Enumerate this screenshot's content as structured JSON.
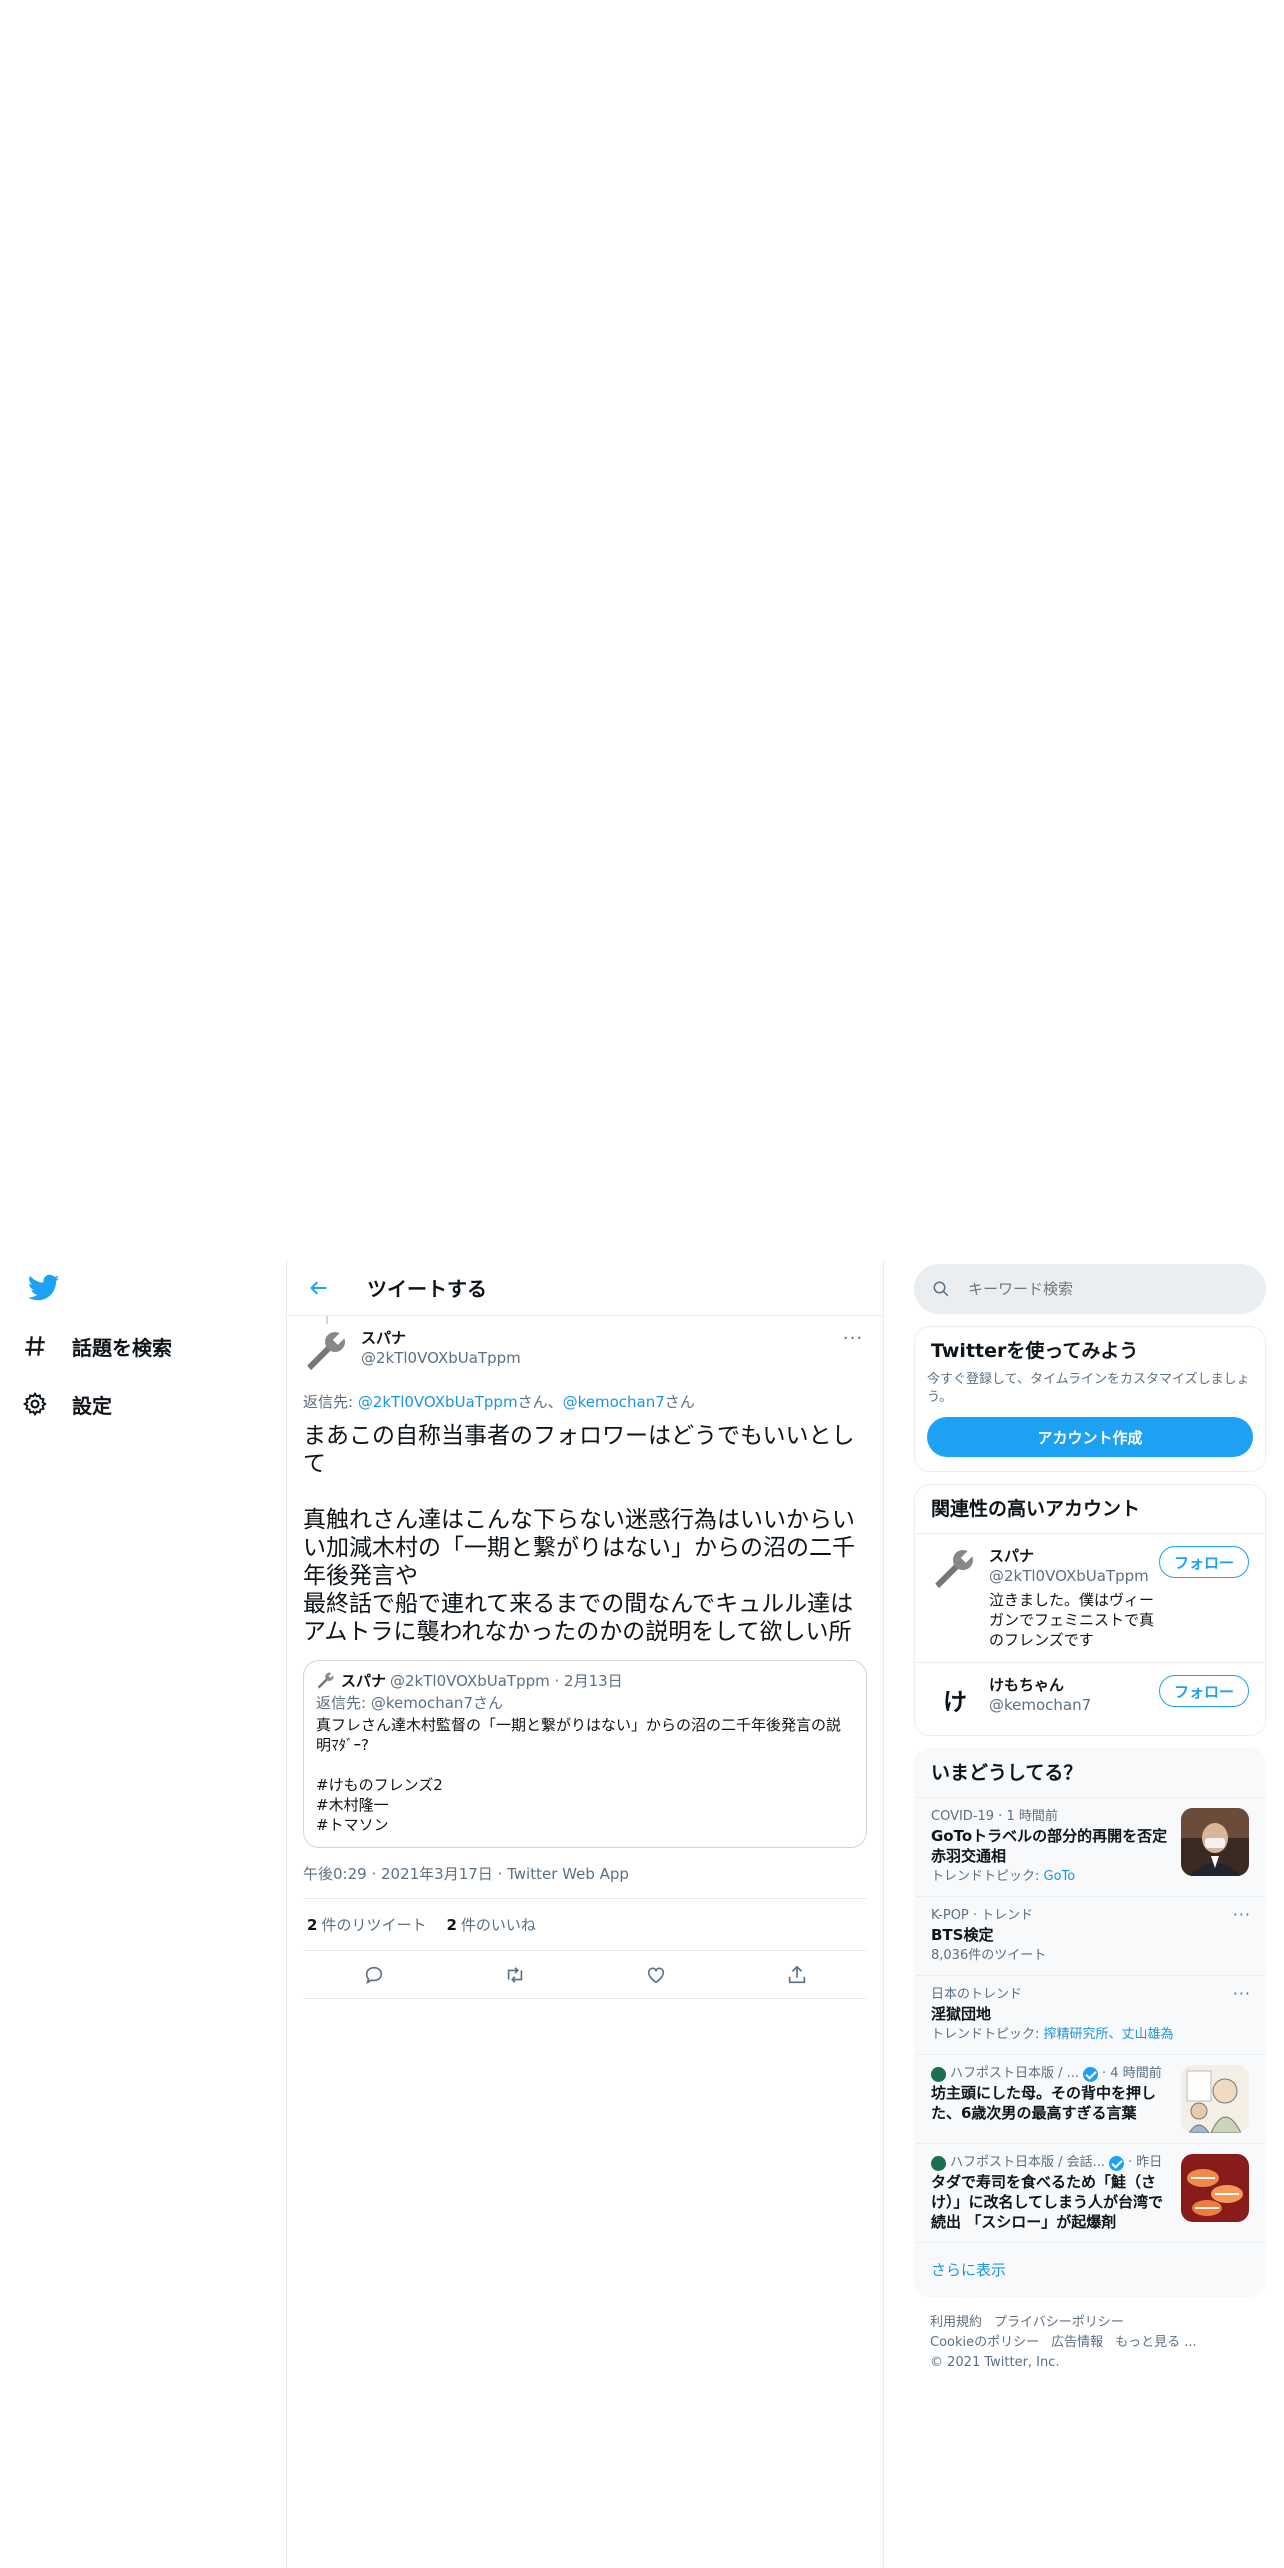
{
  "nav": {
    "logo_icon": "twitter-bird-icon",
    "items": [
      {
        "label": "話題を検索",
        "icon": "hashtag-icon"
      },
      {
        "label": "設定",
        "icon": "gear-icon"
      }
    ]
  },
  "main": {
    "title": "ツイートする",
    "tweet": {
      "name": "スパナ",
      "handle": "@2kTl0VOXbUaTppm",
      "reply_prefix": "返信先: ",
      "reply_user1": "@2kTl0VOXbUaTppm",
      "reply_sep": "さん、",
      "reply_user2": "@kemochan7",
      "reply_suffix": "さん",
      "text": "まあこの自称当事者のフォロワーはどうでもいいとして\n\n真触れさん達はこんな下らない迷惑行為はいいからいい加減木村の「一期と繋がりはない」からの沼の二千年後発言や\n最終話で船で連れて来るまでの間なんでキュルル達はアムトラに襲われなかったのかの説明をして欲しい所",
      "quote": {
        "name": "スパナ",
        "meta": "@2kTl0VOXbUaTppm · 2月13日",
        "reply": "返信先: @kemochan7さん",
        "text": "真フレさん達木村監督の「一期と繋がりはない」からの沼の二千年後発言の説明ﾏﾀﾞｰ?\n\n#けものフレンズ2\n#木村隆一\n#トマソン"
      },
      "timestamp": "午後0:29 · 2021年3月17日 · Twitter Web App",
      "retweet_count": "2",
      "retweet_label": "件のリツイート",
      "like_count": "2",
      "like_label": "件のいいね"
    }
  },
  "sidebar": {
    "search_placeholder": "キーワード検索",
    "signup": {
      "title": "Twitterを使ってみよう",
      "desc": "今すぐ登録して、タイムラインをカスタマイズしましょう。",
      "button": "アカウント作成"
    },
    "related": {
      "title": "関連性の高いアカウント",
      "accounts": [
        {
          "name": "スパナ",
          "handle": "@2kTl0VOXbUaTppm",
          "bio": "泣きました。僕はヴィーガンでフェミニストで真のフレンズです",
          "button": "フォロー"
        },
        {
          "name": "けもちゃん",
          "handle": "@kemochan7",
          "bio": "",
          "button": "フォロー",
          "avatar_char": "け"
        }
      ]
    },
    "trends": {
      "title": "いまどうしてる？",
      "items": [
        {
          "meta": "COVID-19 · 1 時間前",
          "title": "GoToトラベルの部分的再開を否定 赤羽交通相",
          "sub_prefix": "トレンドトピック: ",
          "sub_link": "GoTo"
        },
        {
          "meta": "K-POP · トレンド",
          "title": "BTS検定",
          "sub": "8,036件のツイート"
        },
        {
          "meta": "日本のトレンド",
          "title": "淫獄団地",
          "sub_prefix": "トレンドトピック: ",
          "sub_link": "搾精研究所、丈山雄為"
        },
        {
          "meta_source": "ハフポスト日本版 / ...",
          "meta_time": "· 4 時間前",
          "title": "坊主頭にした母。その背中を押した、6歳次男の最高すぎる言葉"
        },
        {
          "meta_source": "ハフポスト日本版 / 会話...",
          "meta_time": "· 昨日",
          "title": "タダで寿司を食べるため「鮭（さけ）」に改名してしまう人が台湾で続出 「スシロー」が起爆剤"
        }
      ],
      "show_more": "さらに表示"
    },
    "footer": {
      "links": [
        "利用規約",
        "プライバシーポリシー",
        "Cookieのポリシー",
        "広告情報",
        "もっと見る ..."
      ],
      "copyright": "© 2021 Twitter, Inc."
    }
  },
  "colors": {
    "accent": "#1da1f2",
    "link": "#1b95e0",
    "muted": "#5b7083",
    "border": "#e6ecf0"
  }
}
